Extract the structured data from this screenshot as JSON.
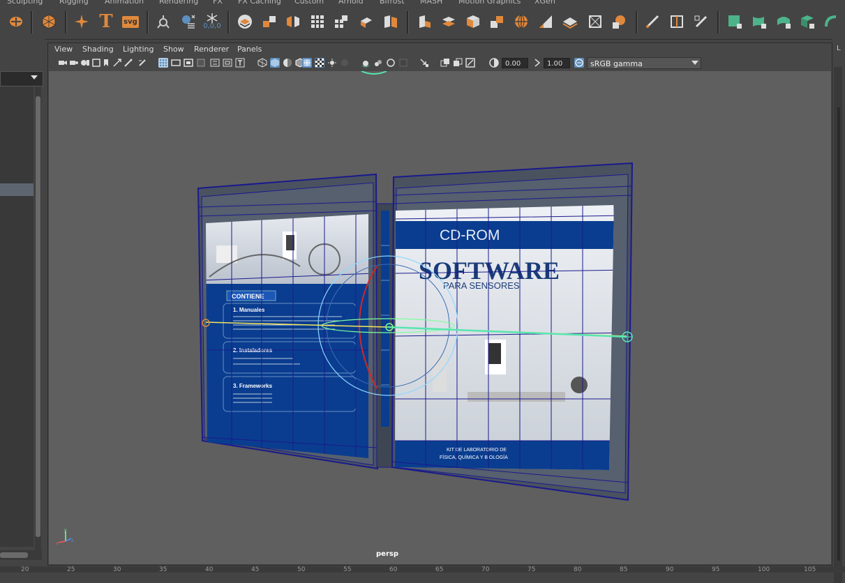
{
  "shelf_tabs": [
    "Sculpting",
    "Rigging",
    "Animation",
    "Rendering",
    "FX",
    "FX Caching",
    "Custom",
    "Arnold",
    "Bifrost",
    "MASH",
    "Motion Graphics",
    "XGen"
  ],
  "shelf": {
    "text_icon_label": "T",
    "svg_icon_label": "svg",
    "snowflake_label": "0,0,0"
  },
  "left_panel": {
    "header": ""
  },
  "viewport": {
    "menus": [
      "View",
      "Shading",
      "Lighting",
      "Show",
      "Renderer",
      "Panels"
    ],
    "exposure": "0.00",
    "gamma": "1.00",
    "color_space": "sRGB gamma",
    "camera_label": "persp"
  },
  "model": {
    "front_header": "CD-ROM",
    "front_title": "SOFTWARE",
    "front_subtitle": "PARA SENSORES",
    "front_footer_line1": "KIT DE LABORATORIO DE",
    "front_footer_line2": "FÍSICA, QUÍMICA Y BIOLOGÍA",
    "back_header": "CONTIENE",
    "back_section1": "1. Manuales",
    "back_section2": "2. Instaladores",
    "back_section3": "3. Frameworks"
  },
  "right_panel": {
    "label": "L"
  },
  "timeline_ticks": [
    "20",
    "25",
    "30",
    "35",
    "40",
    "45",
    "50",
    "55",
    "60",
    "65",
    "70",
    "75",
    "80",
    "85",
    "90",
    "95",
    "100",
    "105"
  ],
  "colors": {
    "accent": "#5c8fbf",
    "shelf_orange": "#e0883c",
    "shelf_green": "#4db38a",
    "wire_blue": "#1a1a8c",
    "cover_blue": "#0a3d8f"
  }
}
